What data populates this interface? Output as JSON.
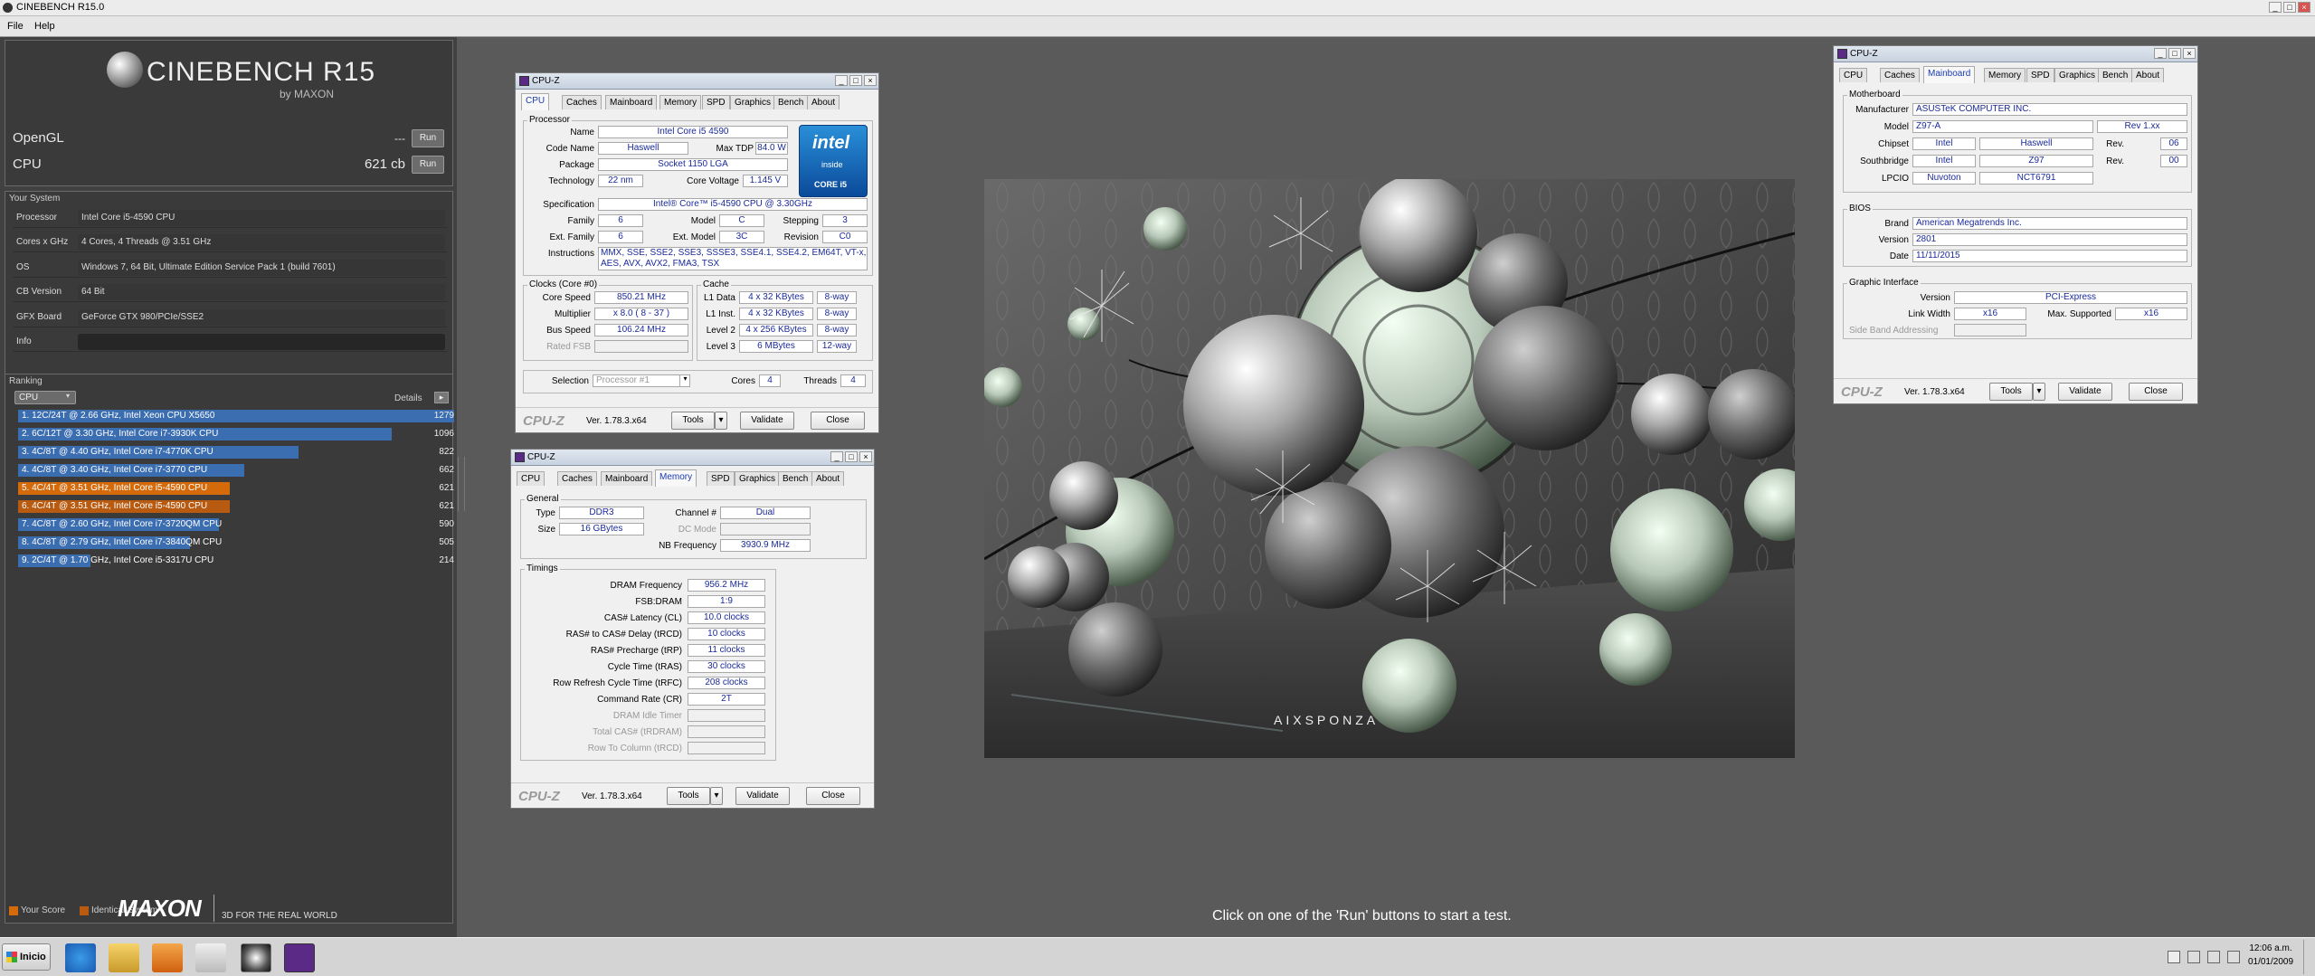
{
  "app": {
    "title": "CINEBENCH R15.0",
    "menu": [
      "File",
      "Help"
    ]
  },
  "brand": {
    "name": "CINEBENCH R15",
    "by": "by MAXON"
  },
  "tests": [
    {
      "label": "OpenGL",
      "score": "---",
      "button": "Run"
    },
    {
      "label": "CPU",
      "score": "621 cb",
      "button": "Run"
    }
  ],
  "system": {
    "heading": "Your System",
    "rows": [
      {
        "k": "Processor",
        "v": "Intel Core i5-4590 CPU"
      },
      {
        "k": "Cores x GHz",
        "v": "4 Cores, 4 Threads @ 3.51 GHz"
      },
      {
        "k": "OS",
        "v": "Windows 7, 64 Bit, Ultimate Edition Service Pack 1 (build 7601)"
      },
      {
        "k": "CB Version",
        "v": "64 Bit"
      },
      {
        "k": "GFX Board",
        "v": "GeForce GTX 980/PCIe/SSE2"
      },
      {
        "k": "Info",
        "v": ""
      }
    ]
  },
  "ranking": {
    "heading": "Ranking",
    "select": "CPU",
    "details": "Details",
    "rows": [
      {
        "label": "1. 12C/24T @ 2.66 GHz, Intel Xeon CPU X5650",
        "score": "1279",
        "frac": 1.0,
        "color": "#3b6db1"
      },
      {
        "label": "2. 6C/12T @ 3.30 GHz,  Intel Core i7-3930K CPU",
        "score": "1096",
        "frac": 0.857,
        "color": "#3b6db1"
      },
      {
        "label": "3. 4C/8T @ 4.40 GHz, Intel Core i7-4770K CPU",
        "score": "822",
        "frac": 0.643,
        "color": "#3b6db1"
      },
      {
        "label": "4. 4C/8T @ 3.40 GHz,  Intel Core i7-3770 CPU",
        "score": "662",
        "frac": 0.518,
        "color": "#3b6db1"
      },
      {
        "label": "5. 4C/4T @ 3.51 GHz, Intel Core i5-4590 CPU",
        "score": "621",
        "frac": 0.486,
        "color": "#d46a0a"
      },
      {
        "label": "6. 4C/4T @ 3.51 GHz, Intel Core i5-4590 CPU",
        "score": "621",
        "frac": 0.486,
        "color": "#b85a10"
      },
      {
        "label": "7. 4C/8T @ 2.60 GHz, Intel Core i7-3720QM CPU",
        "score": "590",
        "frac": 0.461,
        "color": "#3b6db1"
      },
      {
        "label": "8. 4C/8T @ 2.79 GHz,  Intel Core i7-3840QM CPU",
        "score": "505",
        "frac": 0.395,
        "color": "#3b6db1"
      },
      {
        "label": "9. 2C/4T @ 1.70 GHz,  Intel Core i5-3317U CPU",
        "score": "214",
        "frac": 0.167,
        "color": "#3b6db1"
      }
    ],
    "legend": [
      "Your Score",
      "Identical System"
    ]
  },
  "footer": {
    "maxon": "MAXON",
    "tagline": "3D FOR THE REAL WORLD"
  },
  "status": "Click on one of the 'Run' buttons to start a test.",
  "render": {
    "watermark": "AIXSPONZA"
  },
  "cpuz_common": {
    "title": "CPU-Z",
    "logo": "CPU-Z",
    "version": "Ver. 1.78.3.x64",
    "tools": "Tools",
    "validate": "Validate",
    "close": "Close",
    "tabs": [
      "CPU",
      "Caches",
      "Mainboard",
      "Memory",
      "SPD",
      "Graphics",
      "Bench",
      "About"
    ]
  },
  "cpu": {
    "processor_group": "Processor",
    "name_l": "Name",
    "name": "Intel Core i5 4590",
    "code_l": "Code Name",
    "code": "Haswell",
    "tdp_l": "Max TDP",
    "tdp": "84.0 W",
    "pkg_l": "Package",
    "pkg": "Socket 1150 LGA",
    "tech_l": "Technology",
    "tech": "22 nm",
    "volt_l": "Core Voltage",
    "volt": "1.145 V",
    "spec_l": "Specification",
    "spec": "Intel® Core™ i5-4590 CPU @ 3.30GHz",
    "fam_l": "Family",
    "fam": "6",
    "model_l": "Model",
    "model": "C",
    "step_l": "Stepping",
    "step": "3",
    "efam_l": "Ext. Family",
    "efam": "6",
    "emodel_l": "Ext. Model",
    "emodel": "3C",
    "rev_l": "Revision",
    "rev": "C0",
    "instr_l": "Instructions",
    "instr": "MMX, SSE, SSE2, SSE3, SSSE3, SSE4.1, SSE4.2, EM64T, VT-x, AES, AVX, AVX2, FMA3, TSX",
    "clocks_group": "Clocks (Core #0)",
    "cs_l": "Core Speed",
    "cs": "850.21 MHz",
    "mult_l": "Multiplier",
    "mult": "x 8.0 ( 8 - 37 )",
    "bus_l": "Bus Speed",
    "bus": "106.24 MHz",
    "fsb_l": "Rated FSB",
    "cache_group": "Cache",
    "l1d_l": "L1 Data",
    "l1d": "4 x 32 KBytes",
    "l1d_w": "8-way",
    "l1i_l": "L1 Inst.",
    "l1i": "4 x 32 KBytes",
    "l1i_w": "8-way",
    "l2_l": "Level 2",
    "l2": "4 x 256 KBytes",
    "l2_w": "8-way",
    "l3_l": "Level 3",
    "l3": "6 MBytes",
    "l3_w": "12-way",
    "sel_l": "Selection",
    "sel": "Processor #1",
    "cores_l": "Cores",
    "cores": "4",
    "threads_l": "Threads",
    "threads": "4",
    "intel_badge": "intel",
    "intel_inside": "inside",
    "intel_core": "CORE i5"
  },
  "mem": {
    "general_group": "General",
    "type_l": "Type",
    "type": "DDR3",
    "channel_l": "Channel #",
    "channel": "Dual",
    "size_l": "Size",
    "size": "16 GBytes",
    "dc_l": "DC Mode",
    "nb_l": "NB Frequency",
    "nb": "3930.9 MHz",
    "timings_group": "Timings",
    "rows": [
      {
        "k": "DRAM Frequency",
        "v": "956.2 MHz"
      },
      {
        "k": "FSB:DRAM",
        "v": "1:9"
      },
      {
        "k": "CAS# Latency (CL)",
        "v": "10.0 clocks"
      },
      {
        "k": "RAS# to CAS# Delay (tRCD)",
        "v": "10 clocks"
      },
      {
        "k": "RAS# Precharge (tRP)",
        "v": "11 clocks"
      },
      {
        "k": "Cycle Time (tRAS)",
        "v": "30 clocks"
      },
      {
        "k": "Row Refresh Cycle Time (tRFC)",
        "v": "208 clocks"
      },
      {
        "k": "Command Rate (CR)",
        "v": "2T"
      },
      {
        "k": "DRAM Idle Timer",
        "v": ""
      },
      {
        "k": "Total CAS# (tRDRAM)",
        "v": ""
      },
      {
        "k": "Row To Column (tRCD)",
        "v": ""
      }
    ]
  },
  "mb": {
    "mb_group": "Motherboard",
    "man_l": "Manufacturer",
    "man": "ASUSTeK COMPUTER INC.",
    "model_l": "Model",
    "model": "Z97-A",
    "rev": "Rev 1.xx",
    "chip_l": "Chipset",
    "chip_v": "Intel",
    "chip_n": "Haswell",
    "chip_rl": "Rev.",
    "chip_r": "06",
    "sb_l": "Southbridge",
    "sb_v": "Intel",
    "sb_n": "Z97",
    "sb_rl": "Rev.",
    "sb_r": "00",
    "lpc_l": "LPCIO",
    "lpc_v": "Nuvoton",
    "lpc_n": "NCT6791",
    "bios_group": "BIOS",
    "brand_l": "Brand",
    "brand": "American Megatrends Inc.",
    "ver_l": "Version",
    "ver": "2801",
    "date_l": "Date",
    "date": "11/11/2015",
    "gi_group": "Graphic Interface",
    "giv_l": "Version",
    "giv": "PCI-Express",
    "lw_l": "Link Width",
    "lw": "x16",
    "ms_l": "Max. Supported",
    "ms": "x16",
    "sba_l": "Side Band Addressing"
  },
  "taskbar": {
    "start": "Inicio",
    "time": "12:06 a.m.",
    "date": "01/01/2009"
  }
}
